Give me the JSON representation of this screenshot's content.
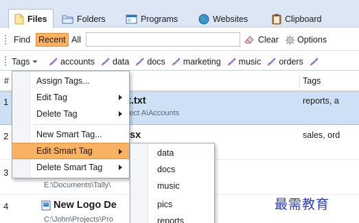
{
  "tabs": [
    {
      "label": "Files",
      "icon": "file-icon",
      "active": true
    },
    {
      "label": "Folders",
      "icon": "folder-icon",
      "active": false
    },
    {
      "label": "Programs",
      "icon": "window-icon",
      "active": false
    },
    {
      "label": "Websites",
      "icon": "globe-icon",
      "active": false
    },
    {
      "label": "Clipboard",
      "icon": "clipboard-icon",
      "active": false
    }
  ],
  "filter": {
    "find_label": "Find",
    "recent_label": "Recent",
    "all_label": "All",
    "search_value": "",
    "clear_label": "Clear",
    "options_label": "Options"
  },
  "tags_bar": {
    "label": "Tags",
    "tags": [
      "accounts",
      "data",
      "docs",
      "marketing",
      "music",
      "orders"
    ]
  },
  "table": {
    "col_num": "#",
    "col_tags": "Tags",
    "rows": [
      {
        "num": "1",
        "title": "t.txt",
        "path": "iect A\\Accounts",
        "tags": "reports, a",
        "selected": true
      },
      {
        "num": "2",
        "title": "sx",
        "path": "",
        "tags": "sales, ord",
        "selected": false
      },
      {
        "num": "3",
        "title": "",
        "path": "E:\\Documents\\Tally\\",
        "tags": "",
        "selected": false
      },
      {
        "num": "4",
        "title": "New Logo De",
        "path": "C:\\John\\Projects\\Pro",
        "tags": "",
        "selected": false
      }
    ]
  },
  "context_menu": {
    "items": [
      {
        "label": "Assign Tags...",
        "submenu": false
      },
      {
        "label": "Edit Tag",
        "submenu": true
      },
      {
        "label": "Delete Tag",
        "submenu": true
      },
      {
        "label": "New Smart Tag...",
        "submenu": false
      },
      {
        "label": "Edit Smart Tag",
        "submenu": true,
        "highlighted": true
      },
      {
        "label": "Delete Smart Tag",
        "submenu": true
      }
    ]
  },
  "submenu": {
    "items": [
      "data",
      "docs",
      "music",
      "pics",
      "reports"
    ]
  },
  "watermark": "最需教育",
  "colors": {
    "accent_highlight": "#f7b264",
    "selection": "#cde0f6",
    "tab_bar": "#dce6f4",
    "tag_icon_purple": "#8a63c2",
    "watermark_blue": "#2b3fb0"
  }
}
